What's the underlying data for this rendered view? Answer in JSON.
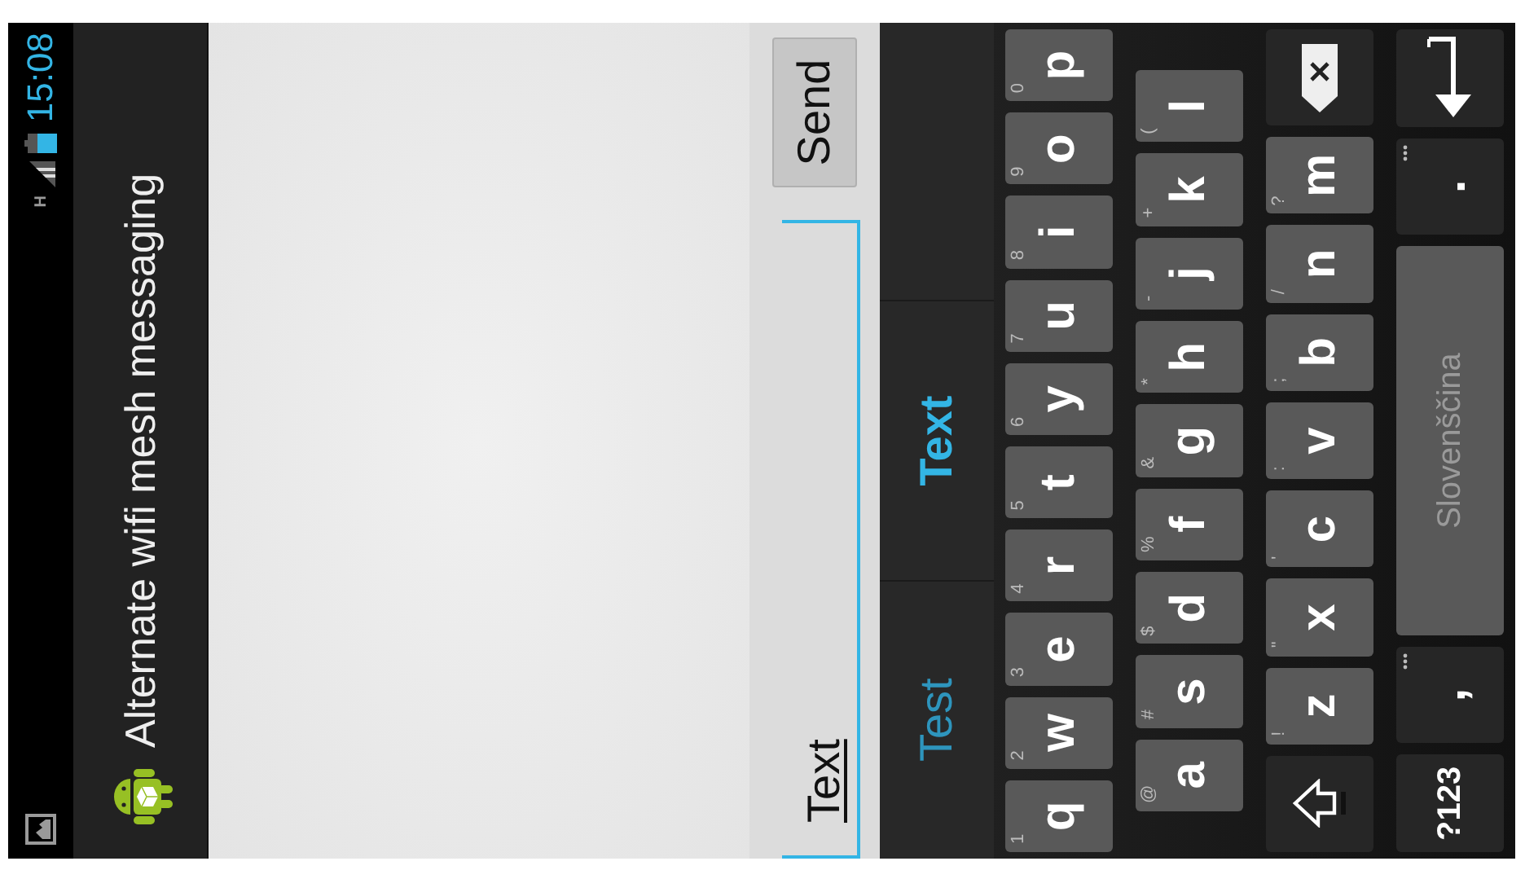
{
  "status_bar": {
    "network": "H",
    "time": "15:08"
  },
  "action_bar": {
    "title": "Alternate wifi mesh messaging"
  },
  "compose": {
    "value": "Text",
    "send_button": "Send"
  },
  "keyboard": {
    "suggestions": [
      {
        "text": "Test",
        "selected": false
      },
      {
        "text": "Text",
        "selected": true
      }
    ],
    "rows": [
      {
        "keys": [
          {
            "kind": "letter",
            "label": "q",
            "hint": "1"
          },
          {
            "kind": "letter",
            "label": "w",
            "hint": "2"
          },
          {
            "kind": "letter",
            "label": "e",
            "hint": "3"
          },
          {
            "kind": "letter",
            "label": "r",
            "hint": "4"
          },
          {
            "kind": "letter",
            "label": "t",
            "hint": "5"
          },
          {
            "kind": "letter",
            "label": "y",
            "hint": "6"
          },
          {
            "kind": "letter",
            "label": "u",
            "hint": "7"
          },
          {
            "kind": "letter",
            "label": "i",
            "hint": "8"
          },
          {
            "kind": "letter",
            "label": "o",
            "hint": "9"
          },
          {
            "kind": "letter",
            "label": "p",
            "hint": "0"
          }
        ]
      },
      {
        "keys": [
          {
            "kind": "letter",
            "label": "a",
            "hint": "@"
          },
          {
            "kind": "letter",
            "label": "s",
            "hint": "#"
          },
          {
            "kind": "letter",
            "label": "d",
            "hint": "$"
          },
          {
            "kind": "letter",
            "label": "f",
            "hint": "%"
          },
          {
            "kind": "letter",
            "label": "g",
            "hint": "&"
          },
          {
            "kind": "letter",
            "label": "h",
            "hint": "*"
          },
          {
            "kind": "letter",
            "label": "j",
            "hint": "-"
          },
          {
            "kind": "letter",
            "label": "k",
            "hint": "+"
          },
          {
            "kind": "letter",
            "label": "l",
            "hint": "("
          }
        ]
      },
      {
        "keys": [
          {
            "kind": "shift"
          },
          {
            "kind": "letter",
            "label": "z",
            "hint": "!"
          },
          {
            "kind": "letter",
            "label": "x",
            "hint": "\""
          },
          {
            "kind": "letter",
            "label": "c",
            "hint": "'"
          },
          {
            "kind": "letter",
            "label": "v",
            "hint": ":"
          },
          {
            "kind": "letter",
            "label": "b",
            "hint": ";"
          },
          {
            "kind": "letter",
            "label": "n",
            "hint": "/"
          },
          {
            "kind": "letter",
            "label": "m",
            "hint": "?"
          },
          {
            "kind": "backspace"
          }
        ]
      },
      {
        "keys": [
          {
            "kind": "mode",
            "label": "?123"
          },
          {
            "kind": "punct",
            "label": ",",
            "more": true
          },
          {
            "kind": "space",
            "label": "Slovenščina"
          },
          {
            "kind": "punct",
            "label": ".",
            "more": true
          },
          {
            "kind": "enter"
          }
        ]
      }
    ]
  }
}
